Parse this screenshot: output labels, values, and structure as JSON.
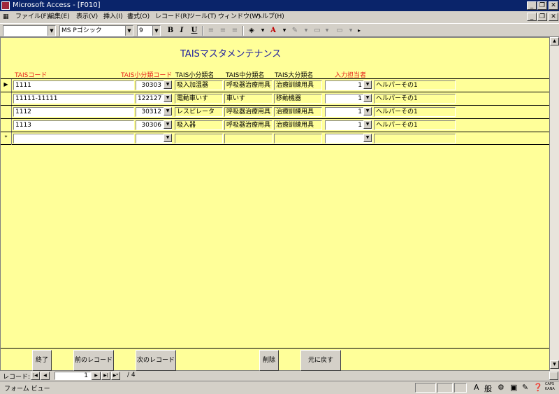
{
  "window": {
    "title": "Microsoft Access - [F010]"
  },
  "menu": [
    {
      "label": "ファイル(F)"
    },
    {
      "label": "編集(E)"
    },
    {
      "label": "表示(V)"
    },
    {
      "label": "挿入(I)"
    },
    {
      "label": "書式(O)"
    },
    {
      "label": "レコード(R)"
    },
    {
      "label": "ツール(T)"
    },
    {
      "label": "ウィンドウ(W)"
    },
    {
      "label": "ヘルプ(H)"
    }
  ],
  "toolbar": {
    "object_combo": "",
    "font": "MS Pゴシック",
    "size": "9",
    "bold": "B",
    "italic": "I",
    "underline": "U"
  },
  "form": {
    "title": "TAISマスタメンテナンス",
    "headers": {
      "tais_code": "TAISコード",
      "small_code": "TAIS小分類コード",
      "small_name": "TAIS小分類名",
      "mid_name": "TAIS中分類名",
      "large_name": "TAIS大分類名",
      "staff": "入力担当者"
    },
    "rows": [
      {
        "code": "1111",
        "small_code": "30303",
        "small_name": "吸入加温器",
        "mid_name": "呼吸器治療用具",
        "large_name": "治療訓練用具",
        "staff_no": "1",
        "staff_name": "ヘルパーその1"
      },
      {
        "code": "11111-11111",
        "small_code": "122127",
        "small_name": "電動車いす",
        "mid_name": "車いす",
        "large_name": "移動機器",
        "staff_no": "1",
        "staff_name": "ヘルパーその1"
      },
      {
        "code": "1112",
        "small_code": "30312",
        "small_name": "レスピレータ",
        "mid_name": "呼吸器治療用具",
        "large_name": "治療訓練用具",
        "staff_no": "1",
        "staff_name": "ヘルパーその1"
      },
      {
        "code": "1113",
        "small_code": "30306",
        "small_name": "吸入器",
        "mid_name": "呼吸器治療用具",
        "large_name": "治療訓練用具",
        "staff_no": "1",
        "staff_name": "ヘルパーその1"
      }
    ],
    "new_row_marker": "*",
    "current_row_marker": "▶",
    "buttons": {
      "close": "終了",
      "prev": "前のレコード",
      "next": "次のレコード",
      "delete": "削除",
      "undo": "元に戻す"
    }
  },
  "nav": {
    "label": "レコード:",
    "current": "1",
    "total": "/ 4"
  },
  "status": {
    "text": "フォーム ビュー",
    "ime1": "A",
    "ime2": "般",
    "caps": "CAPS",
    "kana": "KANA"
  }
}
